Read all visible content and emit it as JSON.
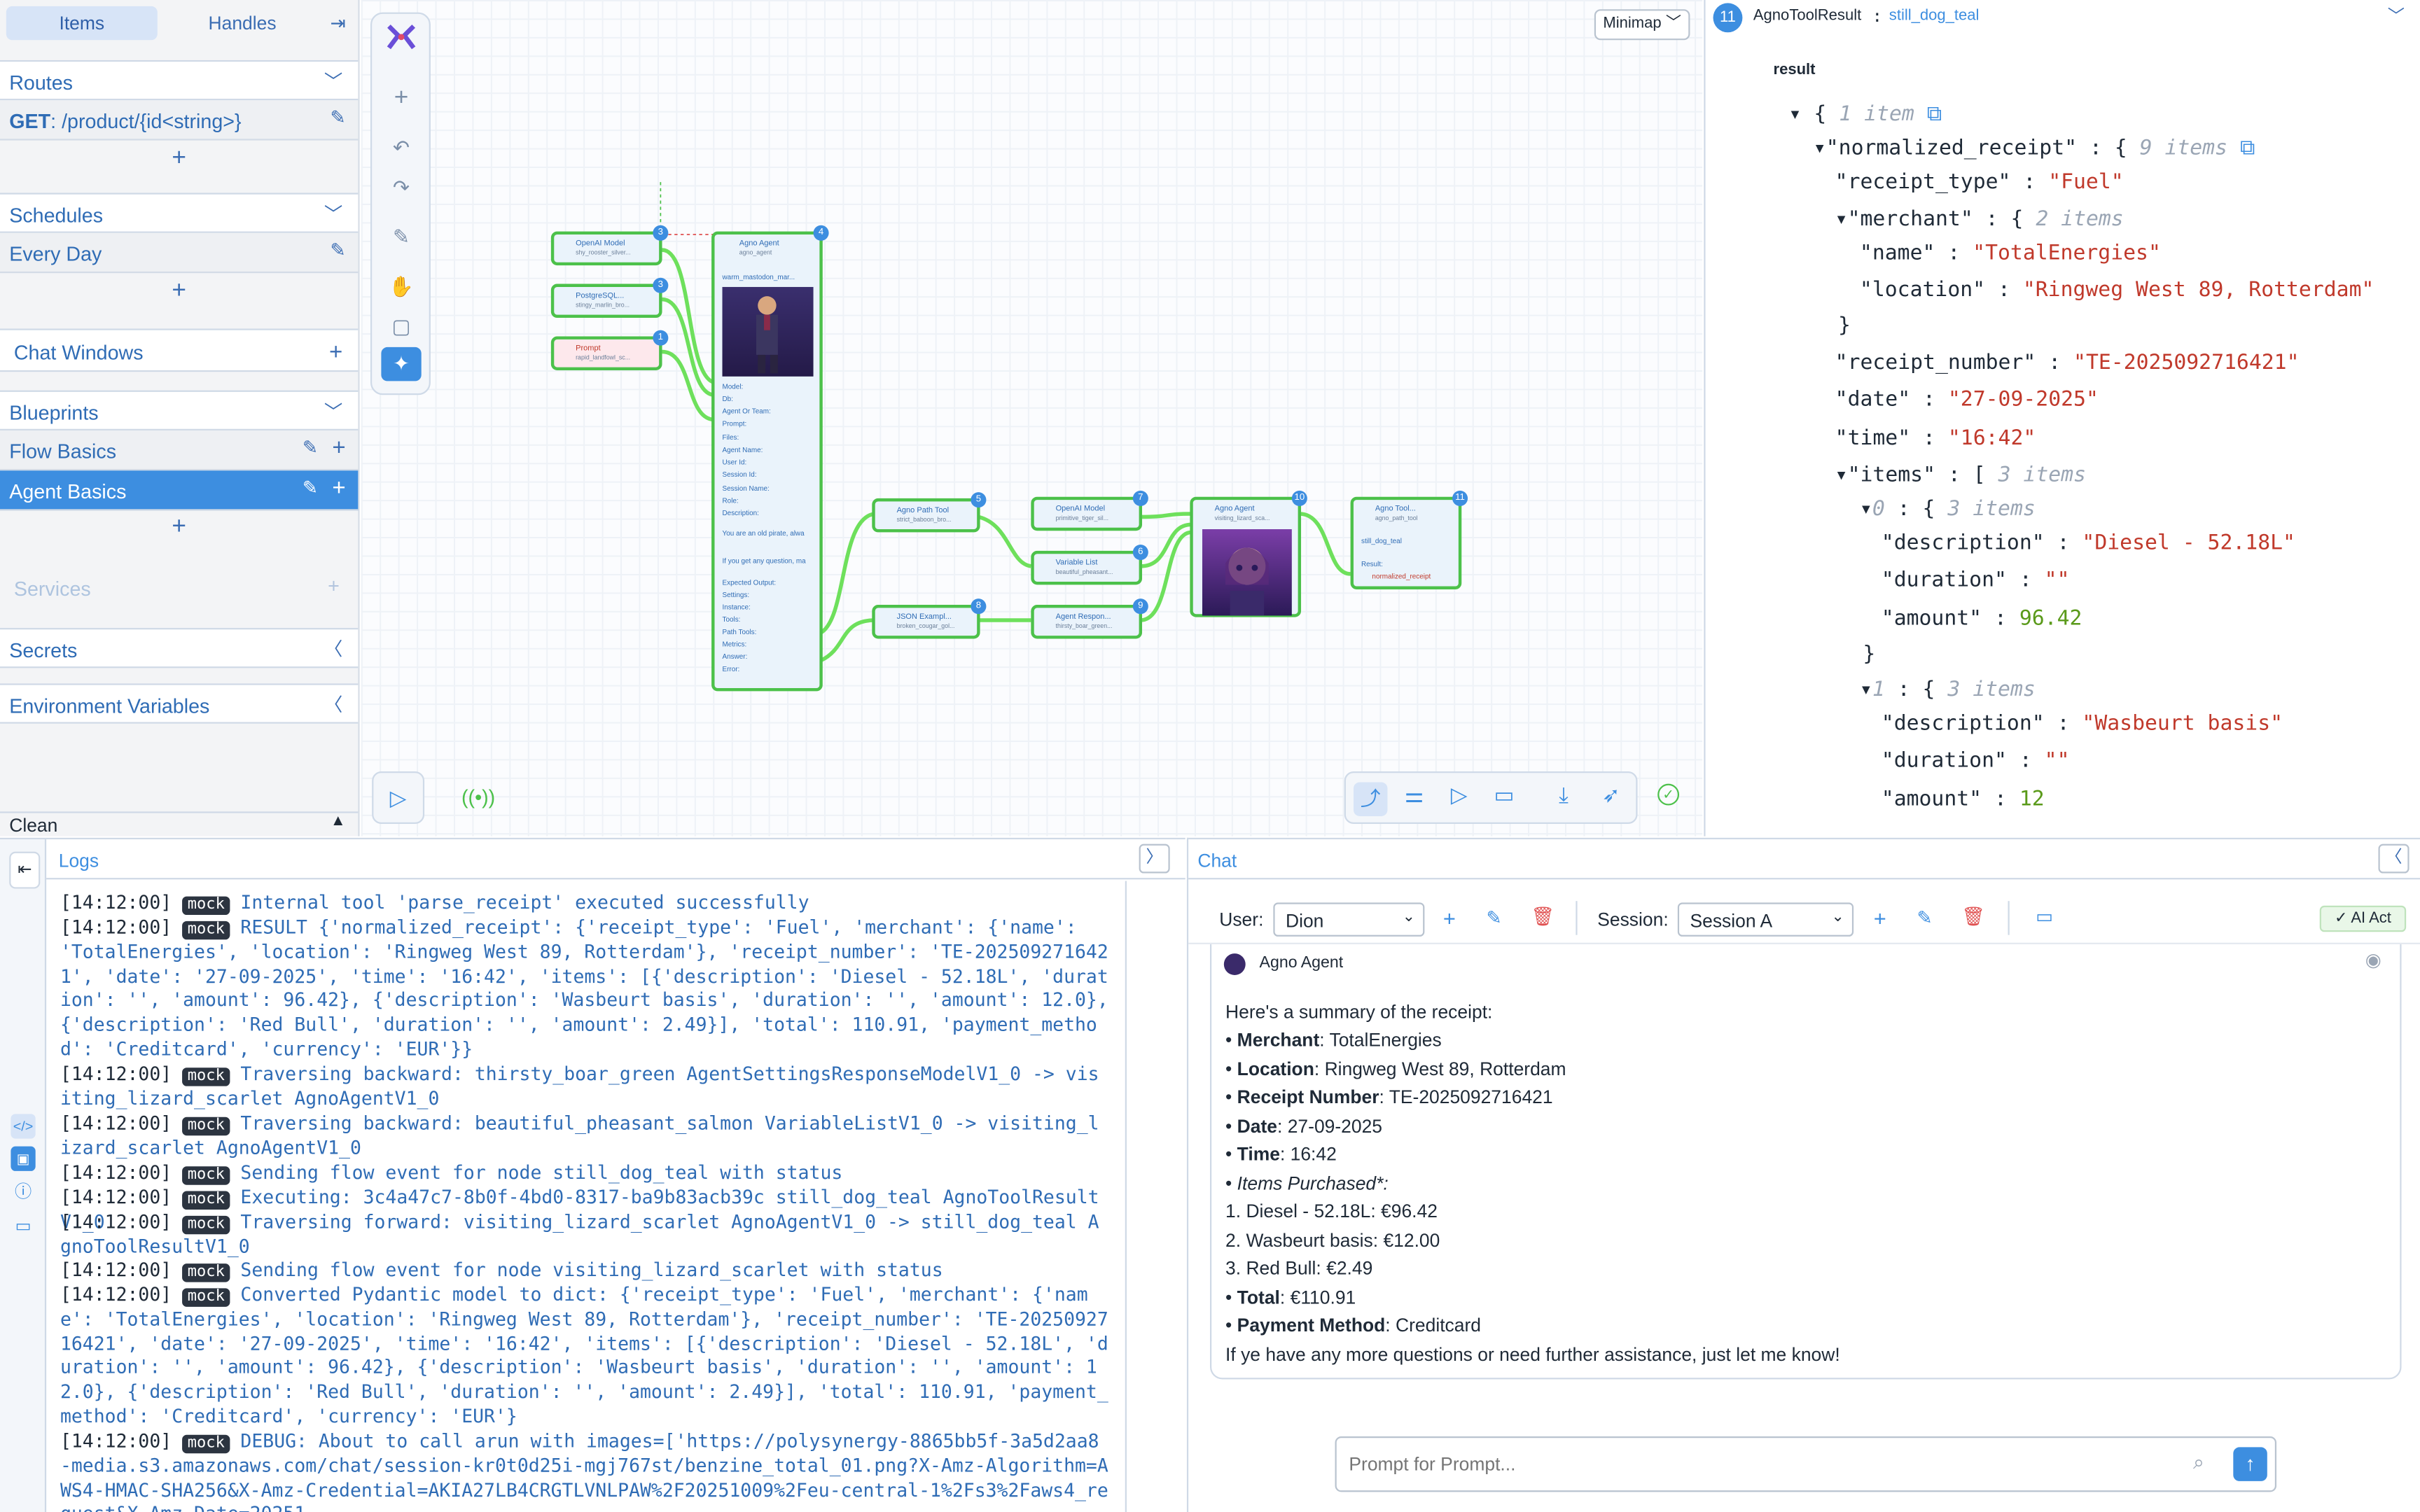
{
  "sidebar": {
    "tabs": [
      "Items",
      "Handles"
    ],
    "routes": {
      "title": "Routes",
      "items": [
        {
          "method": "GET",
          "path": "/product/{id<string>}"
        }
      ]
    },
    "schedules": {
      "title": "Schedules",
      "items": [
        "Every Day"
      ]
    },
    "chat_windows": {
      "title": "Chat Windows"
    },
    "blueprints": {
      "title": "Blueprints",
      "items": [
        "Flow Basics",
        "Agent Basics"
      ]
    },
    "services": {
      "title": "Services"
    },
    "secrets": {
      "title": "Secrets"
    },
    "env": {
      "title": "Environment Variables"
    },
    "clean": "Clean"
  },
  "canvas": {
    "minimap": "Minimap",
    "nodes": [
      {
        "id": "openai1",
        "title": "OpenAI Model",
        "sub": "shy_rooster_silver...",
        "badge": "3"
      },
      {
        "id": "pg",
        "title": "PostgreSQL...",
        "sub": "stingy_marlin_bro...",
        "badge": "3"
      },
      {
        "id": "prompt",
        "title": "Prompt",
        "sub": "rapid_landfowl_sc...",
        "badge": "1"
      },
      {
        "id": "agent1",
        "title": "Agno Agent",
        "sub": "agno_agent",
        "badge": "4",
        "name": "warm_mastodon_mar..."
      },
      {
        "id": "path",
        "title": "Agno Path Tool",
        "sub": "strict_baboon_bro...",
        "badge": "5"
      },
      {
        "id": "json",
        "title": "JSON Exampl...",
        "sub": "broken_cougar_gol...",
        "badge": "8"
      },
      {
        "id": "openai2",
        "title": "OpenAI Model",
        "sub": "primitive_tiger_sil...",
        "badge": "7"
      },
      {
        "id": "varlist",
        "title": "Variable List",
        "sub": "beautiful_pheasant...",
        "badge": "6"
      },
      {
        "id": "resp",
        "title": "Agent Respon...",
        "sub": "thirsty_boar_green...",
        "badge": "9"
      },
      {
        "id": "agent2",
        "title": "Agno Agent",
        "sub": "visiting_lizard_sca...",
        "badge": "10"
      },
      {
        "id": "tool",
        "title": "Agno Tool...",
        "sub": "agno_path_tool",
        "badge": "11",
        "name": "still_dog_teal",
        "result": "Result:",
        "field": "normalized_receipt"
      }
    ],
    "agent_props": [
      "Model:",
      "Db:",
      "Agent Or Team:",
      "Prompt:",
      "Files:",
      "Agent Name:",
      "User Id:",
      "Session Id:",
      "Session Name:",
      "Role:",
      "Description:",
      "You are an old pirate, alwa",
      "If you get any question, ma",
      "Expected Output:",
      "Settings:",
      "Instance:",
      "Tools:",
      "Path Tools:",
      "Metrics:",
      "Answer:",
      "Error:"
    ]
  },
  "result_panel": {
    "badge": "11",
    "type": "AgnoToolResult",
    "sep": ":",
    "name": "still_dog_teal",
    "label": "result",
    "root_meta": "1 item",
    "nr_key": "\"normalized_receipt\"",
    "nr_meta": "9 items",
    "receipt_type": "\"Fuel\"",
    "merchant_meta": "2 items",
    "merchant_name": "\"TotalEnergies\"",
    "merchant_location": "\"Ringweg West 89, Rotterdam\"",
    "receipt_number": "\"TE-2025092716421\"",
    "date": "\"27-09-2025\"",
    "time": "\"16:42\"",
    "items_meta": "3 items",
    "item0_meta": "3 items",
    "item0_desc": "\"Diesel - 52.18L\"",
    "item0_dur": "\"\"",
    "item0_amount": "96.42",
    "item1_meta": "3 items",
    "item1_desc": "\"Wasbeurt basis\"",
    "item1_dur": "\"\"",
    "item1_amount": "12"
  },
  "logs": {
    "title": "Logs",
    "lines": [
      {
        "ts": "[14:12:00]",
        "tag": "mock",
        "text": "Internal tool 'parse_receipt' executed successfully"
      },
      {
        "ts": "[14:12:00]",
        "tag": "mock",
        "text": "RESULT {'normalized_receipt': {'receipt_type': 'Fuel', 'merchant': {'name': 'TotalEnergies', 'location': 'Ringweg West 89, Rotterdam'}, 'receipt_number': 'TE-2025092716421', 'date': '27-09-2025', 'time': '16:42', 'items': [{'description': 'Diesel - 52.18L', 'duration': '', 'amount': 96.42}, {'description': 'Wasbeurt basis', 'duration': '', 'amount': 12.0}, {'description': 'Red Bull', 'duration': '', 'amount': 2.49}], 'total': 110.91, 'payment_method': 'Creditcard', 'currency': 'EUR'}}"
      },
      {
        "ts": "[14:12:00]",
        "tag": "mock",
        "text": "Traversing backward: thirsty_boar_green AgentSettingsResponseModelV1_0 -> visiting_lizard_scarlet AgnoAgentV1_0"
      },
      {
        "ts": "[14:12:00]",
        "tag": "mock",
        "text": "Traversing backward: beautiful_pheasant_salmon VariableListV1_0 -> visiting_lizard_scarlet AgnoAgentV1_0"
      },
      {
        "ts": "[14:12:00]",
        "tag": "mock",
        "text": "Sending flow event for node still_dog_teal with status"
      },
      {
        "ts": "[14:12:00]",
        "tag": "mock",
        "text": "Executing: 3c4a47c7-8b0f-4bd0-8317-ba9b83acb39c still_dog_teal AgnoToolResultV1_0"
      },
      {
        "ts": "[14:12:00]",
        "tag": "mock",
        "text": "Traversing forward: visiting_lizard_scarlet AgnoAgentV1_0 -> still_dog_teal AgnoToolResultV1_0"
      },
      {
        "ts": "[14:12:00]",
        "tag": "mock",
        "text": "Sending flow event for node visiting_lizard_scarlet with status"
      },
      {
        "ts": "[14:12:00]",
        "tag": "mock",
        "text": "Converted Pydantic model to dict: {'receipt_type': 'Fuel', 'merchant': {'name': 'TotalEnergies', 'location': 'Ringweg West 89, Rotterdam'}, 'receipt_number': 'TE-2025092716421', 'date': '27-09-2025', 'time': '16:42', 'items': [{'description': 'Diesel - 52.18L', 'duration': '', 'amount': 96.42}, {'description': 'Wasbeurt basis', 'duration': '', 'amount': 12.0}, {'description': 'Red Bull', 'duration': '', 'amount': 2.49}], 'total': 110.91, 'payment_method': 'Creditcard', 'currency': 'EUR'}"
      },
      {
        "ts": "[14:12:00]",
        "tag": "mock",
        "text": "DEBUG: About to call arun with images=['https://polysynergy-8865bb5f-3a5d2aa8-media.s3.amazonaws.com/chat/session-kr0t0d25i-mgj767st/benzine_total_01.png?X-Amz-Algorithm=AWS4-HMAC-SHA256&X-Amz-Credential=AKIA27LB4CRGTLVNLPAW%2F20251009%2Feu-central-1%2Fs3%2Faws4_request&X-Amz-Date=20251"
      }
    ]
  },
  "chat": {
    "title": "Chat",
    "user_label": "User:",
    "user_value": "Dion",
    "session_label": "Session:",
    "session_value": "Session A",
    "ai_act": "AI Act",
    "agent_name": "Agno Agent",
    "intro": "Here's a summary of the receipt:",
    "merchant_label": "Merchant",
    "merchant_value": ": TotalEnergies",
    "location_label": "Location",
    "location_value": ": Ringweg West 89, Rotterdam",
    "receipt_label": "Receipt Number",
    "receipt_value": ": TE-2025092716421",
    "date_label": "Date",
    "date_value": ": 27-09-2025",
    "time_label": "Time",
    "time_value": ": 16:42",
    "items_label": "Items Purchased*:",
    "item1": "1. Diesel - 52.18L: €96.42",
    "item2": "2. Wasbeurt basis: €12.00",
    "item3": "3. Red Bull: €2.49",
    "total_label": "Total",
    "total_value": ": €110.91",
    "payment_label": "Payment Method",
    "payment_value": ": Creditcard",
    "outro": "If ye have any more questions or need further assistance, just let me know!",
    "prompt_placeholder": "Prompt for Prompt..."
  },
  "colors": {
    "accent": "#3d8ee0",
    "edge": "#4cc14a",
    "string": "#c0392b",
    "number": "#5a9a1a"
  }
}
